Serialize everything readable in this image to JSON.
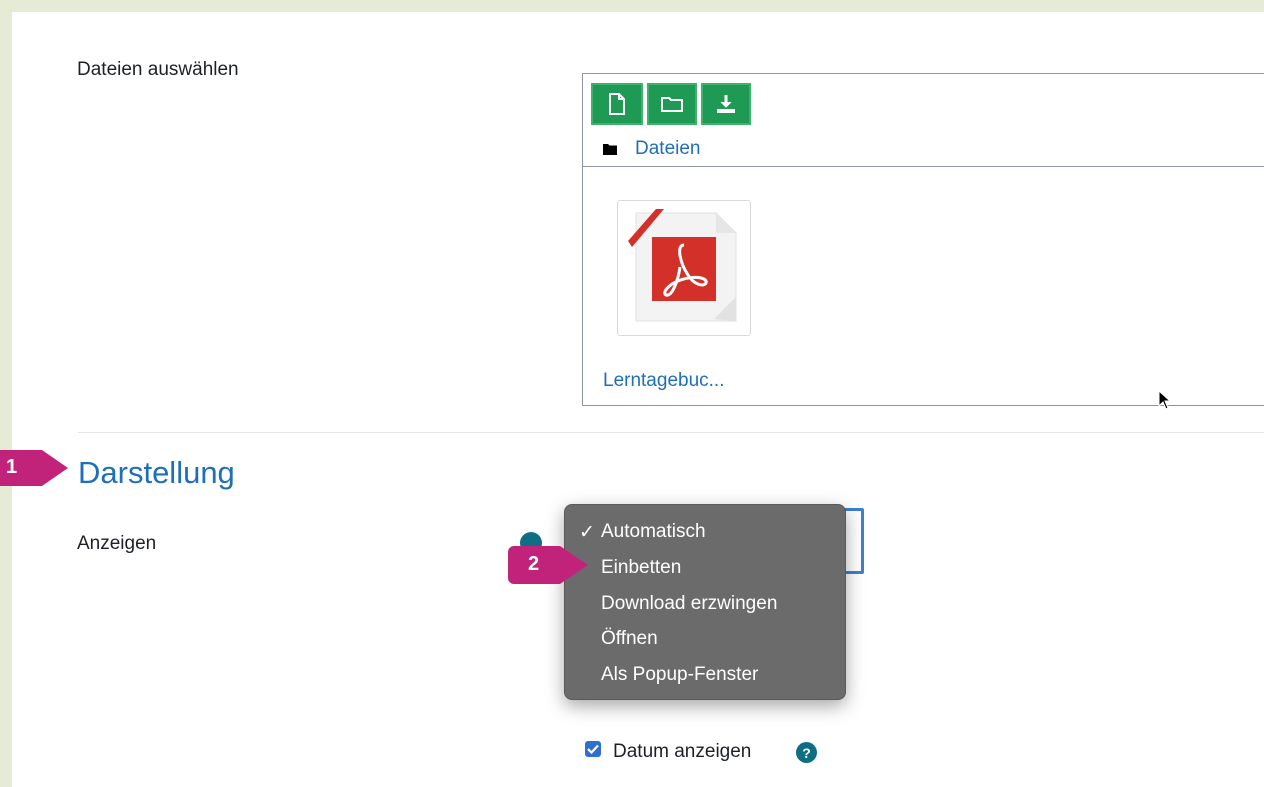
{
  "files_section": {
    "label": "Dateien auswählen",
    "toolbar": [
      {
        "icon": "file-add-icon"
      },
      {
        "icon": "folder-add-icon"
      },
      {
        "icon": "download-icon"
      }
    ],
    "path_root": "Dateien",
    "file_name": "Lerntagebuc..."
  },
  "appearance": {
    "title": "Darstellung",
    "display_label": "Anzeigen",
    "dropdown": {
      "selected": "Automatisch",
      "options": [
        "Automatisch",
        "Einbetten",
        "Download erzwingen",
        "Öffnen",
        "Als Popup-Fenster"
      ],
      "checkmark": "✓"
    },
    "show_date_label": "Datum anzeigen",
    "show_date_checked": true
  },
  "markers": [
    {
      "number": "1",
      "color": "#c2237a"
    },
    {
      "number": "2",
      "color": "#c2237a"
    }
  ],
  "colors": {
    "accent_green": "#1f9a55",
    "link_blue": "#1f6fb8",
    "marker_magenta": "#c2237a",
    "help_teal": "#0f6e84"
  }
}
